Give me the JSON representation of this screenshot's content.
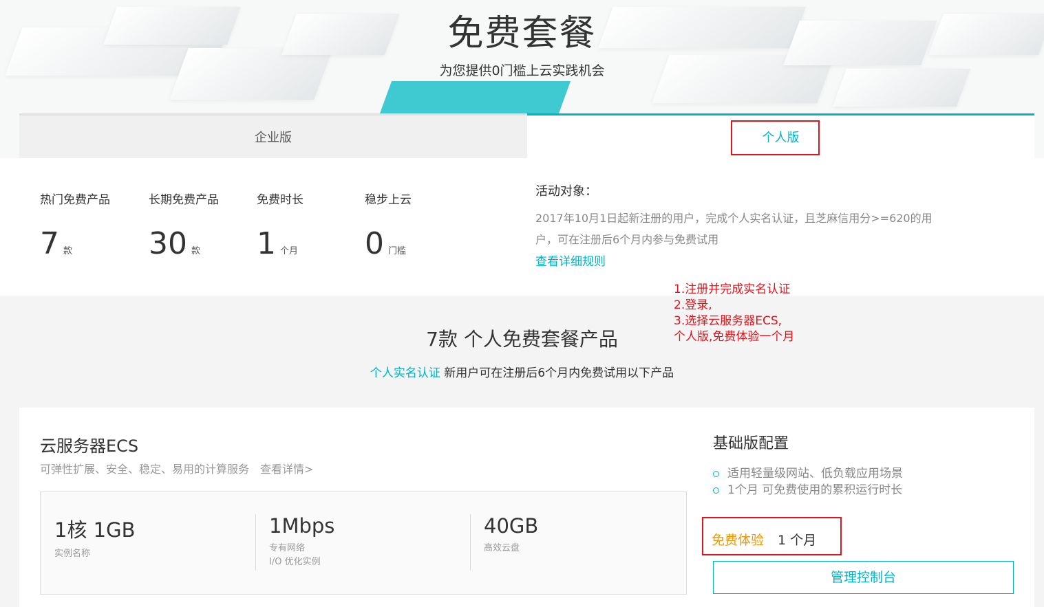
{
  "hero": {
    "title": "免费套餐",
    "subtitle": "为您提供0门槛上云实践机会"
  },
  "tabs": [
    {
      "label": "企业版",
      "active": false
    },
    {
      "label": "个人版",
      "active": true
    }
  ],
  "stats": [
    {
      "label": "热门免费产品",
      "value": "7",
      "unit": "款"
    },
    {
      "label": "长期免费产品",
      "value": "30",
      "unit": "款"
    },
    {
      "label": "免费时长",
      "value": "1",
      "unit": "个月"
    },
    {
      "label": "稳步上云",
      "value": "0",
      "unit": "门槛"
    }
  ],
  "activity": {
    "title": "活动对象：",
    "description": "2017年10月1日起新注册的用户，完成个人实名认证，且芝麻信用分>=620的用户，可在注册后6个月内参与免费试用",
    "link": "查看详细规则"
  },
  "annotation": {
    "lines": [
      "1.注册并完成实名认证",
      "2.登录,",
      "3.选择云服务器ECS,",
      "个人版,免费体验一个月"
    ]
  },
  "section": {
    "title": "7款 个人免费套餐产品",
    "subtitle_link": "个人实名认证",
    "subtitle_rest": " 新用户可在注册后6个月内免费试用以下产品"
  },
  "product": {
    "name": "云服务器ECS",
    "description": "可弹性扩展、安全、稳定、易用的计算服务",
    "details_link": "查看详情>",
    "specs": [
      {
        "value": "1核 1GB",
        "label": "实例名称",
        "label2": ""
      },
      {
        "value": "1Mbps",
        "label": "专有网络",
        "label2": "I/O 优化实例"
      },
      {
        "value": "40GB",
        "label": "高效云盘",
        "label2": ""
      }
    ],
    "config_title": "基础版配置",
    "config_items": [
      "适用轻量级网站、低负载应用场景",
      "1个月 可免费使用的累积运行时长"
    ],
    "trial_label": "免费体验",
    "trial_value": "1 个月",
    "manage_button": "管理控制台"
  },
  "colors": {
    "accent": "#00b3c6",
    "annotation": "#e0141b",
    "trial": "#f39800"
  }
}
